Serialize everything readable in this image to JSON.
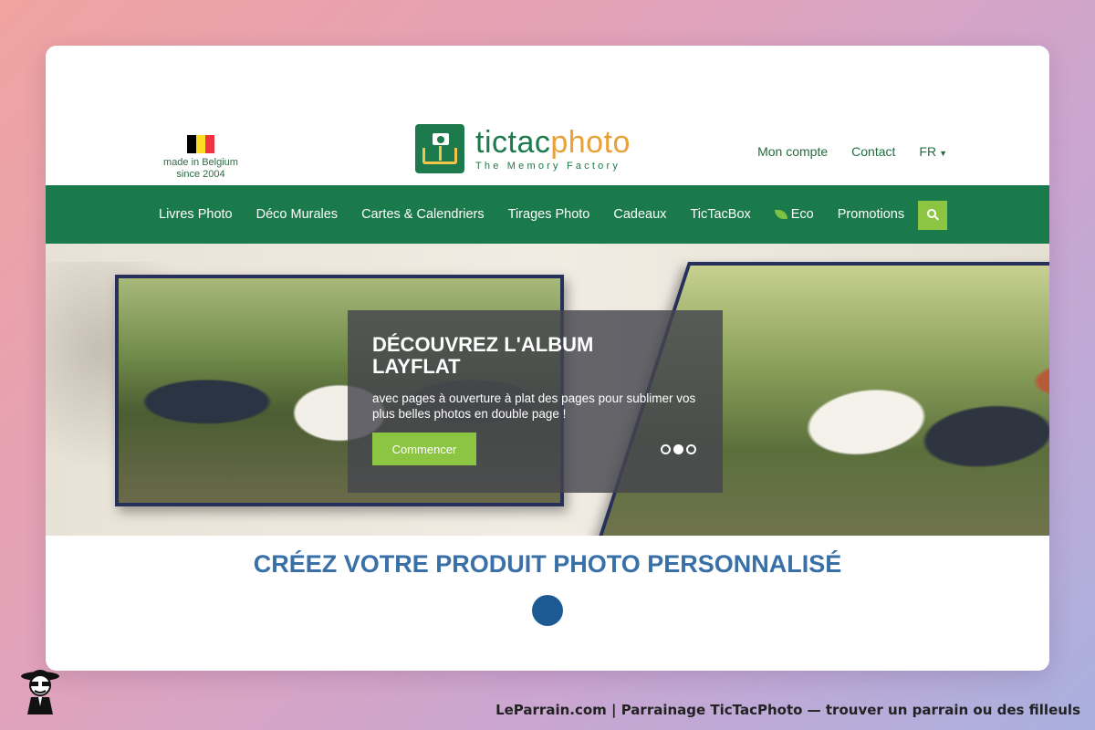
{
  "header": {
    "badge": {
      "line1": "made in Belgium",
      "line2": "since 2004",
      "flag_colors": [
        "#000000",
        "#fdda24",
        "#ef3340"
      ]
    },
    "logo": {
      "name_part1": "tictac",
      "name_part2": "photo",
      "tagline": "The Memory Factory",
      "colors": {
        "green": "#1d7a4c",
        "orange": "#e9a137"
      }
    },
    "links": {
      "account": "Mon compte",
      "contact": "Contact",
      "language": "FR"
    }
  },
  "nav": {
    "items": [
      "Livres Photo",
      "Déco Murales",
      "Cartes & Calendriers",
      "Tirages Photo",
      "Cadeaux",
      "TicTacBox",
      "Eco",
      "Promotions"
    ],
    "search_icon": "search-icon",
    "background": "#1b7a4b",
    "accent": "#8bc541"
  },
  "hero": {
    "title": "DÉCOUVREZ L'ALBUM LAYFLAT",
    "text": "avec pages à ouverture à plat des pages pour sublimer vos plus belles photos en double page !",
    "cta": "Commencer",
    "slides": 3,
    "active_slide": 2
  },
  "section": {
    "title": "CRÉEZ VOTRE PRODUIT PHOTO PERSONNALISÉ"
  },
  "footer": {
    "caption": "LeParrain.com | Parrainage TicTacPhoto — trouver un parrain ou des filleuls"
  }
}
